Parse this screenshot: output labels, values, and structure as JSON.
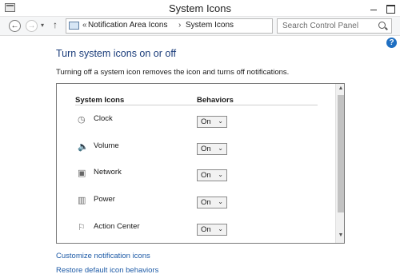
{
  "window": {
    "title": "System Icons",
    "app_icon": "control-panel-window-icon",
    "minimize_icon": "minimize-icon",
    "maximize_icon": "maximize-icon"
  },
  "nav": {
    "back_glyph": "←",
    "forward_glyph": "→",
    "recent_glyph": "▾",
    "up_glyph": "↑",
    "breadcrumb": {
      "overflow_glyph": "«",
      "items": [
        "Notification Area Icons",
        "System Icons"
      ],
      "separator": "›"
    },
    "dropdown_glyph": "⌄",
    "refresh_glyph": "↻",
    "search_placeholder": "Search Control Panel"
  },
  "help_glyph": "?",
  "page": {
    "title": "Turn system icons on or off",
    "description": "Turning off a system icon removes the icon and turns off notifications."
  },
  "table": {
    "col_icons": "System Icons",
    "col_behaviors": "Behaviors",
    "rows": [
      {
        "label": "Clock",
        "icon": "clock-icon",
        "glyph": "◷",
        "value": "On"
      },
      {
        "label": "Volume",
        "icon": "volume-icon",
        "glyph": "🔈",
        "value": "On"
      },
      {
        "label": "Network",
        "icon": "network-icon",
        "glyph": "▣",
        "value": "On"
      },
      {
        "label": "Power",
        "icon": "power-icon",
        "glyph": "▥",
        "value": "On"
      },
      {
        "label": "Action Center",
        "icon": "flag-icon",
        "glyph": "⚐",
        "value": "On"
      }
    ],
    "select_arrow": "⌄",
    "scroll_up_glyph": "▲",
    "scroll_down_glyph": "▼"
  },
  "links": {
    "customize": "Customize notification icons",
    "restore": "Restore default icon behaviors"
  },
  "colors": {
    "title_blue": "#1a3c7a",
    "link_blue": "#1d5aa6",
    "help_blue": "#1f6fc2"
  }
}
